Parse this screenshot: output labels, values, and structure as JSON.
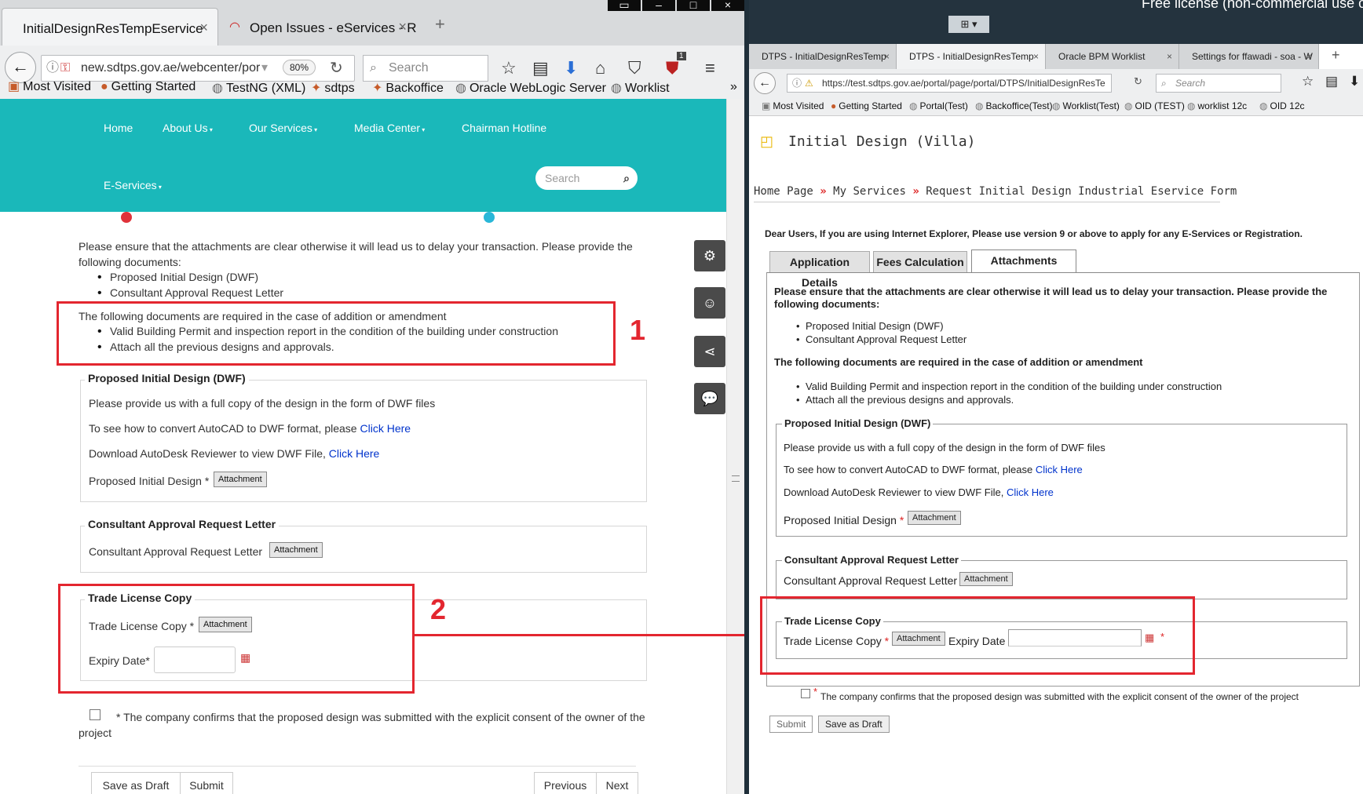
{
  "left": {
    "tabs": [
      {
        "title": "InitialDesignResTempEservice"
      },
      {
        "title": "Open Issues - eServices - Red"
      }
    ],
    "url": "new.sdtps.gov.ae/webcenter/por",
    "zoom": "80%",
    "search_placeholder": "Search",
    "badge": "1",
    "bookmarks": [
      "Most Visited",
      "Getting Started",
      "TestNG (XML)",
      "sdtps",
      "Backoffice",
      "Oracle WebLogic Server",
      "Worklist"
    ],
    "menu": [
      "Home",
      "About Us",
      "Our Services",
      "Media Center",
      "Chairman Hotline",
      "E-Services"
    ],
    "site_search_placeholder": "Search",
    "intro": "Please ensure that the attachments are clear otherwise it will lead us to delay your transaction. Please provide the following documents:",
    "required_docs": [
      "Proposed Initial Design (DWF)",
      "Consultant Approval Request Letter"
    ],
    "amend_text": "The following documents are required in the case of addition or amendment",
    "amend_docs": [
      "Valid Building Permit and inspection report in the condition of the building under construction",
      "Attach all the previous designs and approvals."
    ],
    "dwf": {
      "legend": "Proposed Initial Design (DWF)",
      "line1": "Please provide us with a full copy of the design in the form of DWF files",
      "line2": "To see how to convert AutoCAD to DWF format, please",
      "line3": "Download AutoDesk Reviewer to view DWF File,",
      "click_here": "Click Here",
      "field_label": "Proposed Initial Design",
      "attach": "Attachment"
    },
    "consultant": {
      "legend": "Consultant Approval Request Letter",
      "field_label": "Consultant Approval Request Letter",
      "attach": "Attachment"
    },
    "trade": {
      "legend": "Trade License Copy",
      "field_label": "Trade License Copy",
      "attach": "Attachment",
      "expiry_label": "Expiry Date"
    },
    "required_star": "*",
    "consent": "* The company confirms that the proposed design was submitted with the explicit consent of the owner of the project",
    "buttons": {
      "save_draft": "Save as Draft",
      "submit": "Submit",
      "previous": "Previous",
      "next": "Next"
    }
  },
  "annotations": {
    "box1": "1",
    "box2": "2",
    "color": "#e3262f"
  },
  "right": {
    "top_banner": "Free license (non-commercial use o",
    "tabs": [
      "DTPS - InitialDesignResTemp",
      "DTPS - InitialDesignResTemp",
      "Oracle BPM Worklist",
      "Settings for ffawadi - soa - W"
    ],
    "url": "https://test.sdtps.gov.ae/portal/page/portal/DTPS/InitialDesignResTe",
    "search_placeholder": "Search",
    "bookmarks": [
      "Most Visited",
      "Getting Started",
      "Portal(Test)",
      "Backoffice(Test)",
      "Worklist(Test)",
      "OID (TEST)",
      "worklist 12c",
      "OID 12c"
    ],
    "page_title": "Initial Design (Villa)",
    "breadcrumb": [
      "Home Page",
      "My Services",
      "Request Initial Design Industrial Eservice Form"
    ],
    "ie_notice": "Dear Users, If you are using Internet Explorer, Please use version 9 or above to apply for any E-Services or Registration.",
    "form_tabs": [
      "Application Details",
      "Fees Calculation",
      "Attachments"
    ],
    "intro": "Please ensure that the attachments are clear otherwise it will lead us to delay your transaction. Please provide the following documents:",
    "required_docs": [
      "Proposed Initial Design (DWF)",
      "Consultant Approval Request Letter"
    ],
    "amend_text": "The following documents are required in the case of addition or amendment",
    "amend_docs": [
      "Valid Building Permit and inspection report in the condition of the building under construction",
      "Attach all the previous designs and approvals."
    ],
    "dwf": {
      "legend": "Proposed Initial Design (DWF)",
      "line1": "Please provide us with a full copy of the design in the form of DWF files",
      "line2": "To see how to convert AutoCAD to DWF format, please",
      "line3": "Download AutoDesk Reviewer to view DWF File,",
      "click_here": "Click Here",
      "field_label": "Proposed Initial Design",
      "attach": "Attachment"
    },
    "consultant": {
      "legend": "Consultant Approval Request Letter",
      "field_label": "Consultant Approval Request Letter",
      "attach": "Attachment"
    },
    "trade": {
      "legend": "Trade License Copy",
      "field_label": "Trade License Copy",
      "attach": "Attachment",
      "expiry_label": "Expiry Date"
    },
    "consent": "The company confirms that the proposed design was submitted with the explicit consent of the owner of the project",
    "buttons": {
      "submit": "Submit",
      "save_draft": "Save as Draft"
    }
  }
}
